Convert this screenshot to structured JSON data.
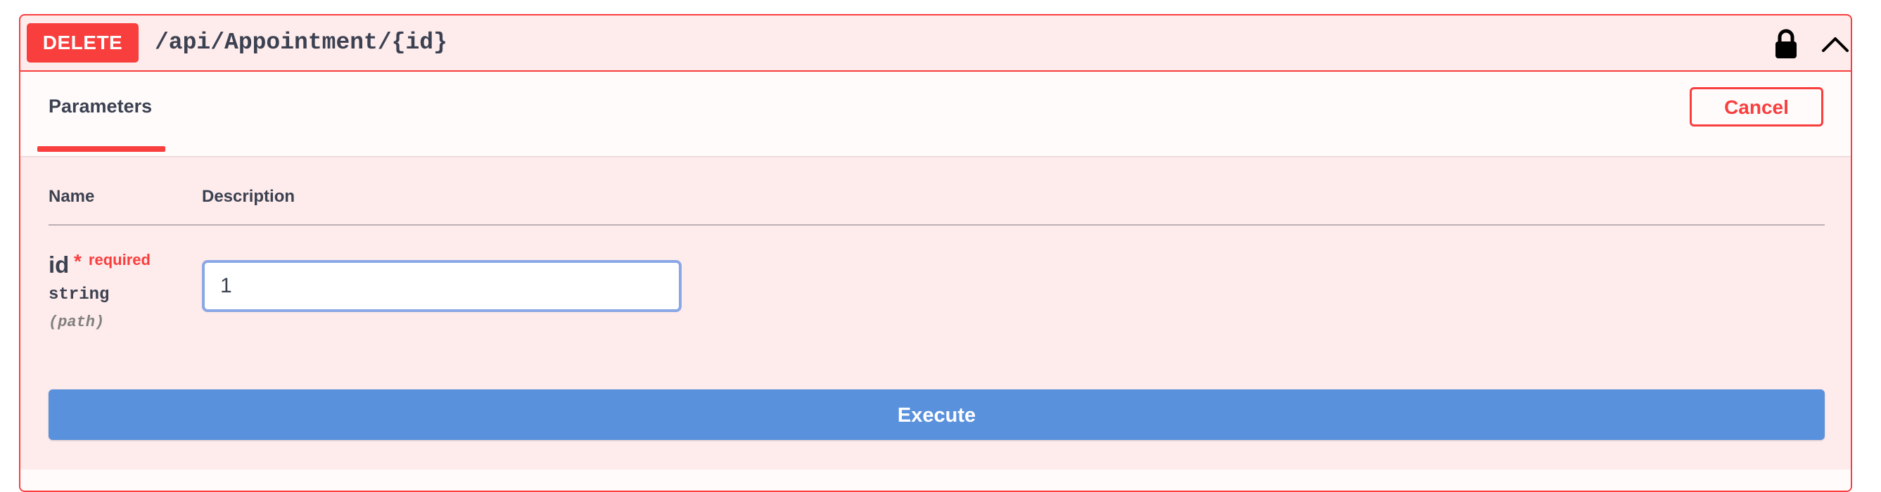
{
  "operation": {
    "method": "DELETE",
    "path": "/api/Appointment/{id}",
    "icons": [
      "lock-icon",
      "chevron-up-icon"
    ],
    "colors": {
      "method": "#f93e3e",
      "execute": "#5a91dc",
      "input_focus": "#8aa7e6"
    }
  },
  "tabs": {
    "parameters_label": "Parameters",
    "cancel_label": "Cancel"
  },
  "parameters_table": {
    "headers": {
      "name": "Name",
      "description": "Description"
    },
    "rows": [
      {
        "name": "id",
        "required_star": "*",
        "required_label": "required",
        "type": "string",
        "location": "(path)",
        "value": "1"
      }
    ]
  },
  "actions": {
    "execute_label": "Execute"
  }
}
